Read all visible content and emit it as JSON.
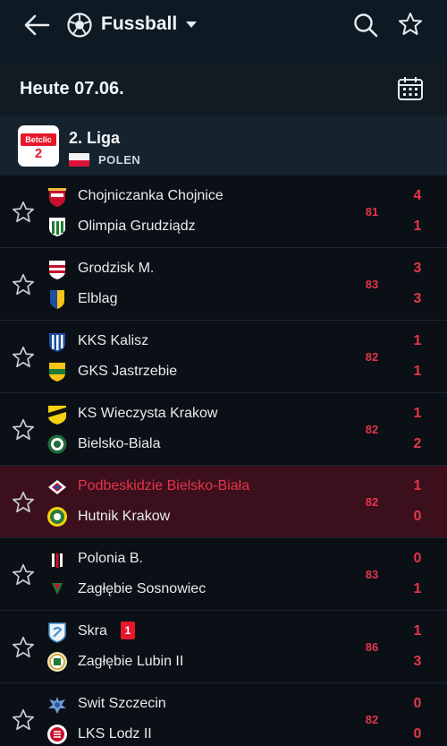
{
  "header": {
    "title": "Fussball",
    "icons": [
      "back-arrow-icon",
      "soccer-ball-icon",
      "caret-down-icon",
      "search-icon",
      "star-icon"
    ]
  },
  "date_row": {
    "label": "Heute 07.06.",
    "icon": "calendar-icon"
  },
  "league": {
    "logo_brand": "Betclic",
    "logo_number": "2",
    "name": "2. Liga",
    "country": "POLEN"
  },
  "colors": {
    "accent": "#e6354b",
    "live_row": "#3b0f1c",
    "background": "#0a1016"
  },
  "matches": [
    {
      "home": "Chojniczanka Chojnice",
      "away": "Olimpia Grudziądz",
      "minute": "81",
      "home_score": "4",
      "away_score": "1"
    },
    {
      "home": "Grodzisk M.",
      "away": "Elblag",
      "minute": "83",
      "home_score": "3",
      "away_score": "3"
    },
    {
      "home": "KKS Kalisz",
      "away": "GKS Jastrzebie",
      "minute": "82",
      "home_score": "1",
      "away_score": "1"
    },
    {
      "home": "KS Wieczysta Krakow",
      "away": "Bielsko-Biala",
      "minute": "82",
      "home_score": "1",
      "away_score": "2"
    },
    {
      "home": "Podbeskidzie Bielsko-Biała",
      "away": "Hutnik Krakow",
      "minute": "82",
      "home_score": "1",
      "away_score": "0"
    },
    {
      "home": "Polonia B.",
      "away": "Zagłębie Sosnowiec",
      "minute": "83",
      "home_score": "0",
      "away_score": "1"
    },
    {
      "home": "Skra",
      "away": "Zagłębie Lubin II",
      "minute": "86",
      "home_score": "1",
      "away_score": "3",
      "red_card": "1"
    },
    {
      "home": "Swit Szczecin",
      "away": "LKS Lodz II",
      "minute": "82",
      "home_score": "0",
      "away_score": "0"
    }
  ]
}
